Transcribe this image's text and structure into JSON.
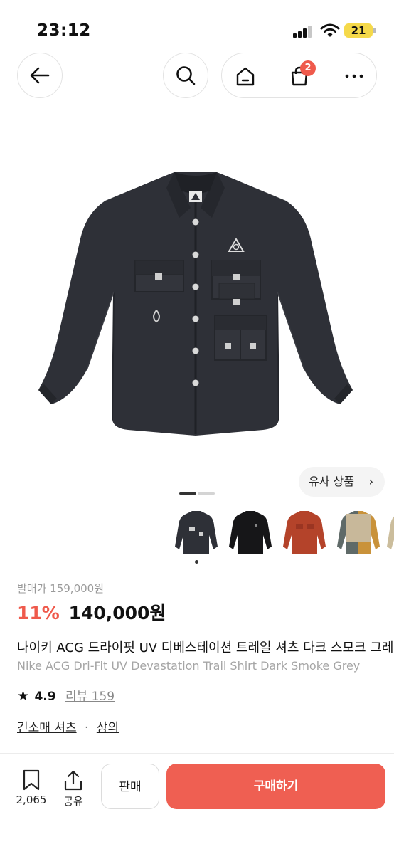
{
  "status_bar": {
    "time": "23:12",
    "battery": "21",
    "icons": [
      "signal-icon",
      "wifi-icon",
      "battery-icon"
    ]
  },
  "nav": {
    "icons": [
      "back-arrow-icon",
      "search-icon",
      "home-icon",
      "shopping-bag-icon",
      "more-icon"
    ],
    "cart_badge": "2"
  },
  "gallery": {
    "similar_button_label": "유사 상품",
    "thumbnails": [
      "dark-smoke-grey-shirt",
      "black-shirt",
      "rust-orange-shirt",
      "beige-grey-mustard-shirt",
      "beige-shirt"
    ]
  },
  "product": {
    "release_price": "발매가 159,000원",
    "discount": "11%",
    "price": "140,000원",
    "title_ko": "나이키 ACG 드라이핏 UV 디베스테이션 트레일 셔츠 다크 스모크 그레이",
    "title_en": "Nike ACG Dri-Fit UV Devastation Trail Shirt Dark Smoke Grey",
    "rating": "4.9",
    "review_label": "리뷰 159",
    "categories": [
      "긴소매 셔츠",
      "상의"
    ],
    "category_separator": "·"
  },
  "bottom_bar": {
    "save_count": "2,065",
    "share_label": "공유",
    "sell_label": "판매",
    "buy_label": "구매하기"
  },
  "colors": {
    "accent": "#ef5a4c",
    "buy_button": "#ef5f52",
    "shirt": "#2e3037"
  }
}
